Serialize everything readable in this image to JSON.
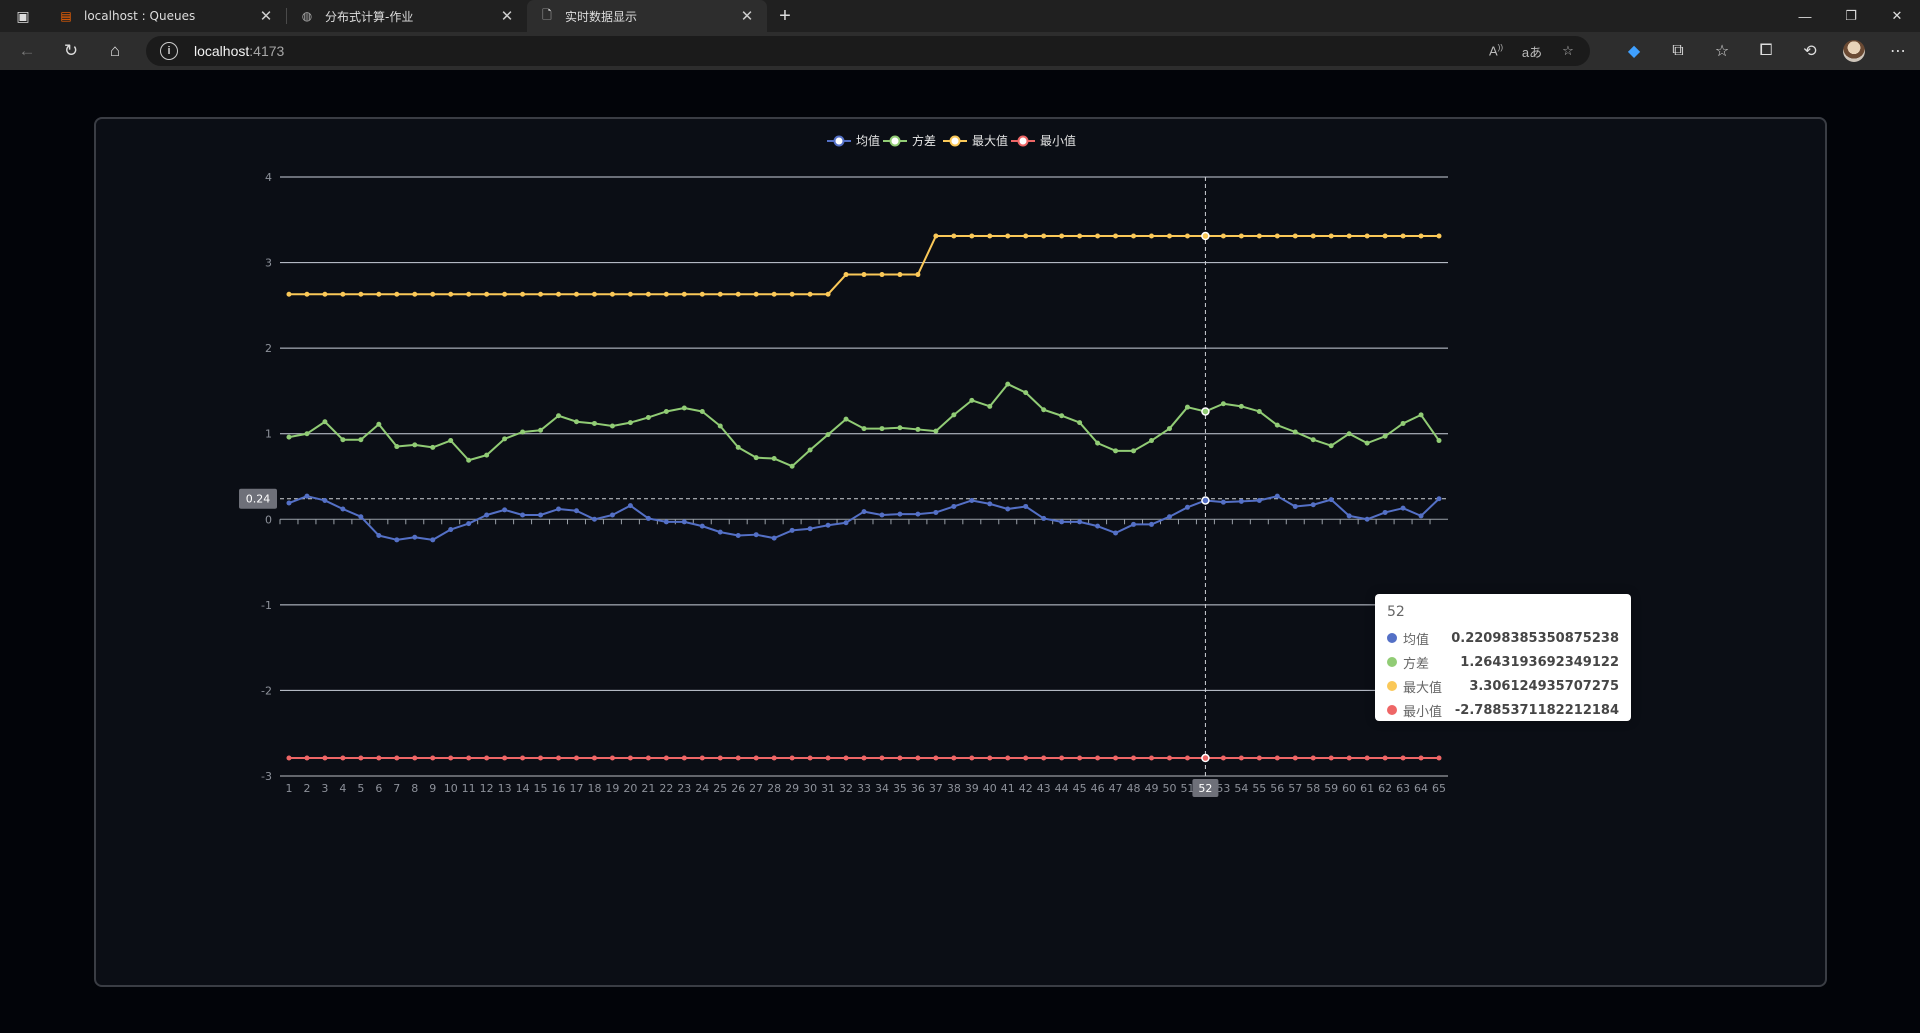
{
  "browser": {
    "tabs": [
      {
        "title": "localhost : Queues",
        "icon": "rabbitmq-icon",
        "active": false
      },
      {
        "title": "分布式计算-作业",
        "icon": "globe-icon",
        "active": false
      },
      {
        "title": "实时数据显示",
        "icon": "page-icon",
        "active": true
      }
    ],
    "url_host": "localhost",
    "url_port": ":4173"
  },
  "chart_data": {
    "type": "line",
    "x": [
      1,
      2,
      3,
      4,
      5,
      6,
      7,
      8,
      9,
      10,
      11,
      12,
      13,
      14,
      15,
      16,
      17,
      18,
      19,
      20,
      21,
      22,
      23,
      24,
      25,
      26,
      27,
      28,
      29,
      30,
      31,
      32,
      33,
      34,
      35,
      36,
      37,
      38,
      39,
      40,
      41,
      42,
      43,
      44,
      45,
      46,
      47,
      48,
      49,
      50,
      51,
      52,
      53,
      54,
      55,
      56,
      57,
      58,
      59,
      60,
      61,
      62,
      63,
      64,
      65
    ],
    "ylim": [
      -3,
      4
    ],
    "yticks": [
      4,
      3,
      2,
      1,
      0,
      -1,
      -2,
      -3
    ],
    "legend_position": "top-center",
    "grid": true,
    "series": [
      {
        "name": "均值",
        "color": "#5470c6",
        "values": [
          0.19,
          0.27,
          0.22,
          0.12,
          0.03,
          -0.19,
          -0.24,
          -0.21,
          -0.24,
          -0.12,
          -0.05,
          0.05,
          0.11,
          0.05,
          0.05,
          0.12,
          0.1,
          0.0,
          0.05,
          0.16,
          0.01,
          -0.03,
          -0.03,
          -0.08,
          -0.15,
          -0.19,
          -0.18,
          -0.22,
          -0.13,
          -0.11,
          -0.07,
          -0.04,
          0.09,
          0.05,
          0.06,
          0.06,
          0.08,
          0.15,
          0.22,
          0.18,
          0.12,
          0.15,
          0.01,
          -0.03,
          -0.03,
          -0.08,
          -0.16,
          -0.06,
          -0.06,
          0.03,
          0.14,
          0.22,
          0.2,
          0.21,
          0.22,
          0.27,
          0.15,
          0.17,
          0.23,
          0.04,
          0.0,
          0.08,
          0.13,
          0.04,
          0.24
        ]
      },
      {
        "name": "方差",
        "color": "#91cc75",
        "values": [
          0.96,
          1.0,
          1.14,
          0.93,
          0.93,
          1.11,
          0.85,
          0.87,
          0.84,
          0.92,
          0.69,
          0.75,
          0.94,
          1.02,
          1.04,
          1.21,
          1.14,
          1.12,
          1.09,
          1.13,
          1.19,
          1.26,
          1.3,
          1.26,
          1.09,
          0.84,
          0.72,
          0.71,
          0.62,
          0.81,
          0.99,
          1.17,
          1.06,
          1.06,
          1.07,
          1.05,
          1.03,
          1.22,
          1.39,
          1.32,
          1.58,
          1.48,
          1.28,
          1.21,
          1.13,
          0.89,
          0.8,
          0.8,
          0.92,
          1.06,
          1.31,
          1.26,
          1.35,
          1.32,
          1.26,
          1.1,
          1.02,
          0.93,
          0.86,
          1.0,
          0.89,
          0.97,
          1.12,
          1.22,
          0.92
        ]
      },
      {
        "name": "最大值",
        "color": "#fac858",
        "values": [
          2.63,
          2.63,
          2.63,
          2.63,
          2.63,
          2.63,
          2.63,
          2.63,
          2.63,
          2.63,
          2.63,
          2.63,
          2.63,
          2.63,
          2.63,
          2.63,
          2.63,
          2.63,
          2.63,
          2.63,
          2.63,
          2.63,
          2.63,
          2.63,
          2.63,
          2.63,
          2.63,
          2.63,
          2.63,
          2.63,
          2.63,
          2.86,
          2.86,
          2.86,
          2.86,
          2.86,
          3.31,
          3.31,
          3.31,
          3.31,
          3.31,
          3.31,
          3.31,
          3.31,
          3.31,
          3.31,
          3.31,
          3.31,
          3.31,
          3.31,
          3.31,
          3.31,
          3.31,
          3.31,
          3.31,
          3.31,
          3.31,
          3.31,
          3.31,
          3.31,
          3.31,
          3.31,
          3.31,
          3.31,
          3.31
        ]
      },
      {
        "name": "最小值",
        "color": "#ee6666",
        "values": [
          -2.79,
          -2.79,
          -2.79,
          -2.79,
          -2.79,
          -2.79,
          -2.79,
          -2.79,
          -2.79,
          -2.79,
          -2.79,
          -2.79,
          -2.79,
          -2.79,
          -2.79,
          -2.79,
          -2.79,
          -2.79,
          -2.79,
          -2.79,
          -2.79,
          -2.79,
          -2.79,
          -2.79,
          -2.79,
          -2.79,
          -2.79,
          -2.79,
          -2.79,
          -2.79,
          -2.79,
          -2.79,
          -2.79,
          -2.79,
          -2.79,
          -2.79,
          -2.79,
          -2.79,
          -2.79,
          -2.79,
          -2.79,
          -2.79,
          -2.79,
          -2.79,
          -2.79,
          -2.79,
          -2.79,
          -2.79,
          -2.79,
          -2.79,
          -2.79,
          -2.79,
          -2.79,
          -2.79,
          -2.79,
          -2.79,
          -2.79,
          -2.79,
          -2.79,
          -2.79,
          -2.79,
          -2.79,
          -2.79,
          -2.79,
          -2.79
        ]
      }
    ],
    "axis_pointer": {
      "x": 52,
      "y_label": "0.24"
    },
    "tooltip": {
      "title": "52",
      "rows": [
        {
          "name": "均值",
          "value": "0.22098385350875238",
          "color": "#5470c6"
        },
        {
          "name": "方差",
          "value": "1.2643193692349122",
          "color": "#91cc75"
        },
        {
          "name": "最大值",
          "value": "3.306124935707275",
          "color": "#fac858"
        },
        {
          "name": "最小值",
          "value": "-2.7885371182212184",
          "color": "#ee6666"
        }
      ]
    }
  }
}
